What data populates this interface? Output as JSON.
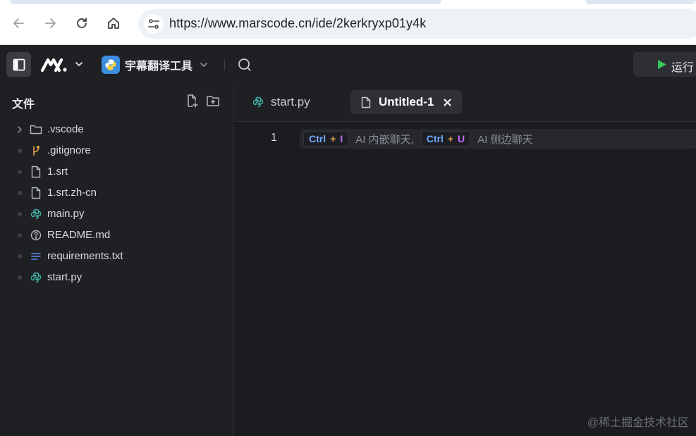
{
  "browser": {
    "url": "https://www.marscode.cn/ide/2kerkryxp01y4k",
    "icons": {
      "back": "back-arrow-icon",
      "forward": "forward-arrow-icon",
      "reload": "reload-icon",
      "home": "home-icon",
      "site_info": "site-info-icon"
    }
  },
  "ide": {
    "project_name": "宇幕翻译工具",
    "run_label": "运行",
    "accent_green": "#34c759",
    "python_badge_color": "#3d8de0"
  },
  "sidebar": {
    "title": "文件",
    "files": [
      {
        "label": ".vscode",
        "icon": "folder-icon",
        "expandable": true
      },
      {
        "label": ".gitignore",
        "icon": "git-branch-icon"
      },
      {
        "label": "1.srt",
        "icon": "file-icon"
      },
      {
        "label": "1.srt.zh-cn",
        "icon": "file-icon"
      },
      {
        "label": "main.py",
        "icon": "python-icon"
      },
      {
        "label": "README.md",
        "icon": "help-circle-icon"
      },
      {
        "label": "requirements.txt",
        "icon": "text-lines-icon"
      },
      {
        "label": "start.py",
        "icon": "python-icon"
      }
    ]
  },
  "editor": {
    "tabs": [
      {
        "label": "start.py",
        "active": false
      },
      {
        "label": "Untitled-1",
        "active": true
      }
    ],
    "line_number": "1",
    "hint": {
      "ctrl": "Ctrl",
      "plus": "+",
      "key1": "I",
      "text1": "AI 内嵌聊天,",
      "key2": "U",
      "text2": "AI 侧边聊天"
    }
  },
  "watermark": "@稀土掘金技术社区"
}
